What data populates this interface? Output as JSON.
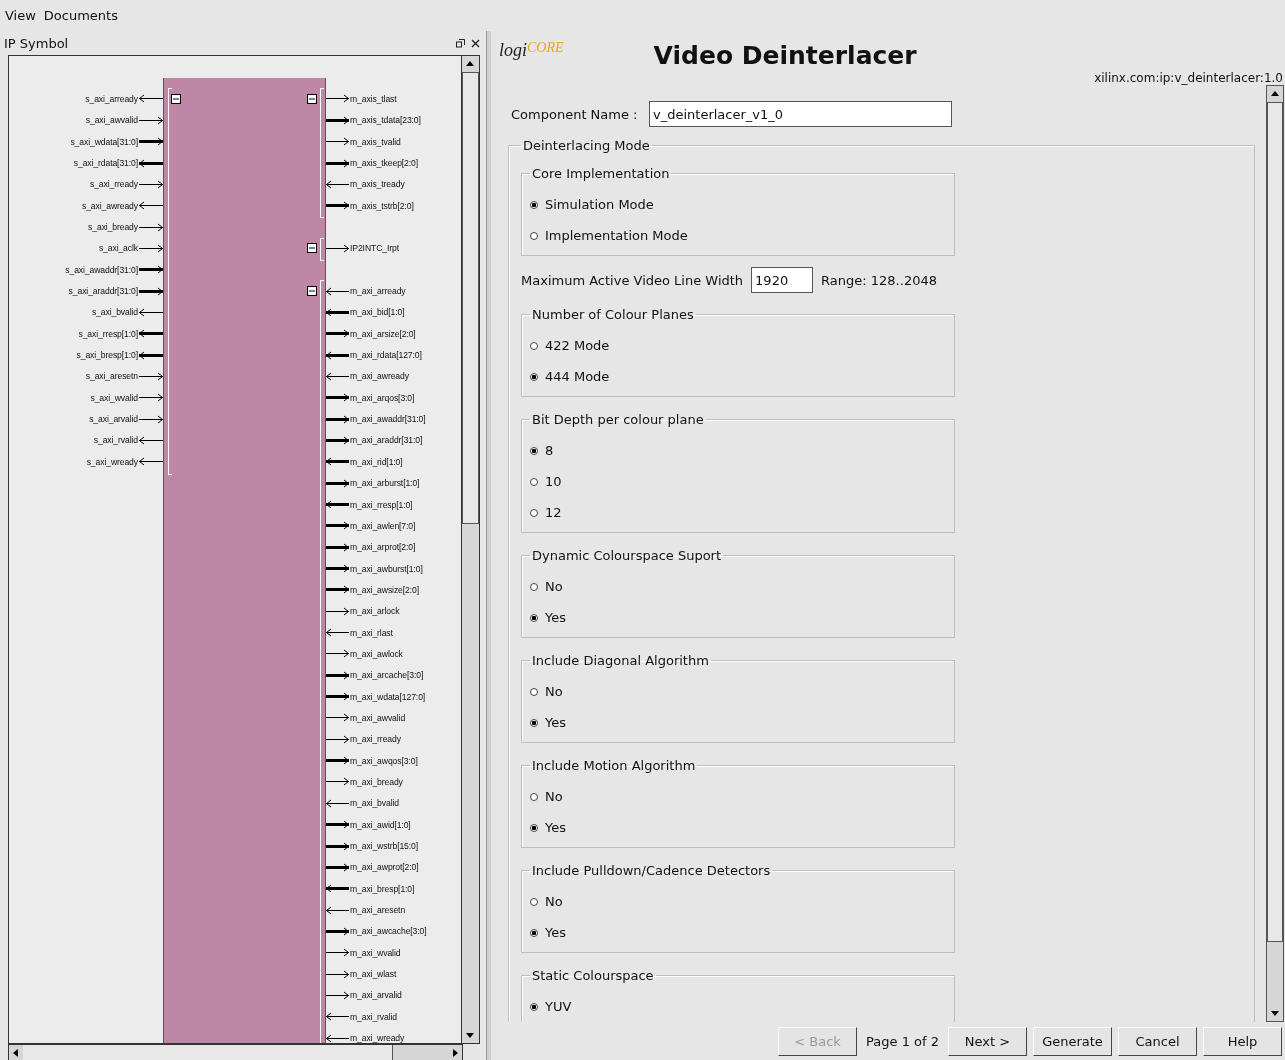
{
  "menu": [
    {
      "label": "View"
    },
    {
      "label": "Documents"
    }
  ],
  "left_panel": {
    "title": "IP Symbol",
    "left_groups": [
      {
        "expanded": true,
        "pins": [
          {
            "name": "s_axi_arready",
            "input": false,
            "bus": false
          },
          {
            "name": "s_axi_awvalid",
            "input": true,
            "bus": false
          },
          {
            "name": "s_axi_wdata[31:0]",
            "input": true,
            "bus": true
          },
          {
            "name": "s_axi_rdata[31:0]",
            "input": false,
            "bus": true
          },
          {
            "name": "s_axi_rready",
            "input": true,
            "bus": false
          },
          {
            "name": "s_axi_awready",
            "input": false,
            "bus": false
          },
          {
            "name": "s_axi_bready",
            "input": true,
            "bus": false
          },
          {
            "name": "s_axi_aclk",
            "input": true,
            "bus": false
          },
          {
            "name": "s_axi_awaddr[31:0]",
            "input": true,
            "bus": true
          },
          {
            "name": "s_axi_araddr[31:0]",
            "input": true,
            "bus": true
          },
          {
            "name": "s_axi_bvalid",
            "input": false,
            "bus": false
          },
          {
            "name": "s_axi_rresp[1:0]",
            "input": false,
            "bus": true
          },
          {
            "name": "s_axi_bresp[1:0]",
            "input": false,
            "bus": true
          },
          {
            "name": "s_axi_aresetn",
            "input": true,
            "bus": false
          },
          {
            "name": "s_axi_wvalid",
            "input": true,
            "bus": false
          },
          {
            "name": "s_axi_arvalid",
            "input": true,
            "bus": false
          },
          {
            "name": "s_axi_rvalid",
            "input": false,
            "bus": false
          },
          {
            "name": "s_axi_wready",
            "input": false,
            "bus": false
          }
        ]
      }
    ],
    "right_groups": [
      {
        "expanded": true,
        "pins": [
          {
            "name": "m_axis_tlast",
            "input": false,
            "bus": false
          },
          {
            "name": "m_axis_tdata[23:0]",
            "input": false,
            "bus": true
          },
          {
            "name": "m_axis_tvalid",
            "input": false,
            "bus": false
          },
          {
            "name": "m_axis_tkeep[2:0]",
            "input": false,
            "bus": true
          },
          {
            "name": "m_axis_tready",
            "input": true,
            "bus": false
          },
          {
            "name": "m_axis_tstrb[2:0]",
            "input": false,
            "bus": true
          }
        ]
      },
      {
        "expanded": true,
        "pins": [
          {
            "name": "IP2INTC_Irpt",
            "input": false,
            "bus": false
          }
        ]
      },
      {
        "expanded": true,
        "pins": [
          {
            "name": "m_axi_arready",
            "input": true,
            "bus": false
          },
          {
            "name": "m_axi_bid[1:0]",
            "input": true,
            "bus": true
          },
          {
            "name": "m_axi_arsize[2:0]",
            "input": false,
            "bus": true
          },
          {
            "name": "m_axi_rdata[127:0]",
            "input": true,
            "bus": true
          },
          {
            "name": "m_axi_awready",
            "input": true,
            "bus": false
          },
          {
            "name": "m_axi_arqos[3:0]",
            "input": false,
            "bus": true
          },
          {
            "name": "m_axi_awaddr[31:0]",
            "input": false,
            "bus": true
          },
          {
            "name": "m_axi_araddr[31:0]",
            "input": false,
            "bus": true
          },
          {
            "name": "m_axi_rid[1:0]",
            "input": true,
            "bus": true
          },
          {
            "name": "m_axi_arburst[1:0]",
            "input": false,
            "bus": true
          },
          {
            "name": "m_axi_rresp[1:0]",
            "input": true,
            "bus": true
          },
          {
            "name": "m_axi_awlen[7:0]",
            "input": false,
            "bus": true
          },
          {
            "name": "m_axi_arprot[2:0]",
            "input": false,
            "bus": true
          },
          {
            "name": "m_axi_awburst[1:0]",
            "input": false,
            "bus": true
          },
          {
            "name": "m_axi_awsize[2:0]",
            "input": false,
            "bus": true
          },
          {
            "name": "m_axi_arlock",
            "input": false,
            "bus": false
          },
          {
            "name": "m_axi_rlast",
            "input": true,
            "bus": false
          },
          {
            "name": "m_axi_awlock",
            "input": false,
            "bus": false
          },
          {
            "name": "m_axi_arcache[3:0]",
            "input": false,
            "bus": true
          },
          {
            "name": "m_axi_wdata[127:0]",
            "input": false,
            "bus": true
          },
          {
            "name": "m_axi_awvalid",
            "input": false,
            "bus": false
          },
          {
            "name": "m_axi_rready",
            "input": false,
            "bus": false
          },
          {
            "name": "m_axi_awqos[3:0]",
            "input": false,
            "bus": true
          },
          {
            "name": "m_axi_bready",
            "input": false,
            "bus": false
          },
          {
            "name": "m_axi_bvalid",
            "input": true,
            "bus": false
          },
          {
            "name": "m_axi_awid[1:0]",
            "input": false,
            "bus": true
          },
          {
            "name": "m_axi_wstrb[15:0]",
            "input": false,
            "bus": true
          },
          {
            "name": "m_axi_awprot[2:0]",
            "input": false,
            "bus": true
          },
          {
            "name": "m_axi_bresp[1:0]",
            "input": true,
            "bus": true
          },
          {
            "name": "m_axi_aresetn",
            "input": true,
            "bus": false
          },
          {
            "name": "m_axi_awcache[3:0]",
            "input": false,
            "bus": true
          },
          {
            "name": "m_axi_wvalid",
            "input": false,
            "bus": false
          },
          {
            "name": "m_axi_wlast",
            "input": false,
            "bus": false
          },
          {
            "name": "m_axi_arvalid",
            "input": false,
            "bus": false
          },
          {
            "name": "m_axi_rvalid",
            "input": true,
            "bus": false
          },
          {
            "name": "m_axi_wready",
            "input": true,
            "bus": false
          }
        ]
      }
    ]
  },
  "header": {
    "logo": [
      "logi",
      "CORE"
    ],
    "title": "Video Deinterlacer",
    "ip_id": "xilinx.com:ip:v_deinterlacer:1.0"
  },
  "form": {
    "component_name": {
      "label": "Component Name :",
      "value": "v_deinterlacer_v1_0"
    },
    "section": {
      "title": "Deinterlacing Mode",
      "items": [
        {
          "kind": "radio_group",
          "title": "Core Implementation",
          "options": [
            {
              "label": "Simulation Mode",
              "selected": true
            },
            {
              "label": "Implementation Mode",
              "selected": false
            }
          ]
        },
        {
          "kind": "field",
          "label": "Maximum Active Video Line Width",
          "value": "1920",
          "range": "Range: 128..2048"
        },
        {
          "kind": "radio_group",
          "title": "Number of Colour Planes",
          "options": [
            {
              "label": "422 Mode",
              "selected": false
            },
            {
              "label": "444 Mode",
              "selected": true
            }
          ]
        },
        {
          "kind": "radio_group",
          "title": "Bit Depth per colour plane",
          "options": [
            {
              "label": "8",
              "selected": true
            },
            {
              "label": "10",
              "selected": false
            },
            {
              "label": "12",
              "selected": false
            }
          ]
        },
        {
          "kind": "radio_group",
          "title": "Dynamic Colourspace Suport",
          "options": [
            {
              "label": "No",
              "selected": false
            },
            {
              "label": "Yes",
              "selected": true
            }
          ]
        },
        {
          "kind": "radio_group",
          "title": "Include Diagonal Algorithm",
          "options": [
            {
              "label": "No",
              "selected": false
            },
            {
              "label": "Yes",
              "selected": true
            }
          ]
        },
        {
          "kind": "radio_group",
          "title": "Include Motion Algorithm",
          "options": [
            {
              "label": "No",
              "selected": false
            },
            {
              "label": "Yes",
              "selected": true
            }
          ]
        },
        {
          "kind": "radio_group",
          "title": "Include Pulldown/Cadence Detectors",
          "options": [
            {
              "label": "No",
              "selected": false
            },
            {
              "label": "Yes",
              "selected": true
            }
          ]
        },
        {
          "kind": "radio_group",
          "title": "Static Colourspace",
          "options": [
            {
              "label": "YUV",
              "selected": true
            }
          ]
        }
      ]
    }
  },
  "footer": {
    "buttons": [
      {
        "label": "< Back",
        "disabled": true
      },
      {
        "kind": "page",
        "label": "Page 1 of 2"
      },
      {
        "label": "Next >",
        "disabled": false
      },
      {
        "label": "Generate",
        "disabled": false
      },
      {
        "label": "Cancel",
        "disabled": false
      },
      {
        "label": "Help",
        "disabled": false
      }
    ]
  }
}
